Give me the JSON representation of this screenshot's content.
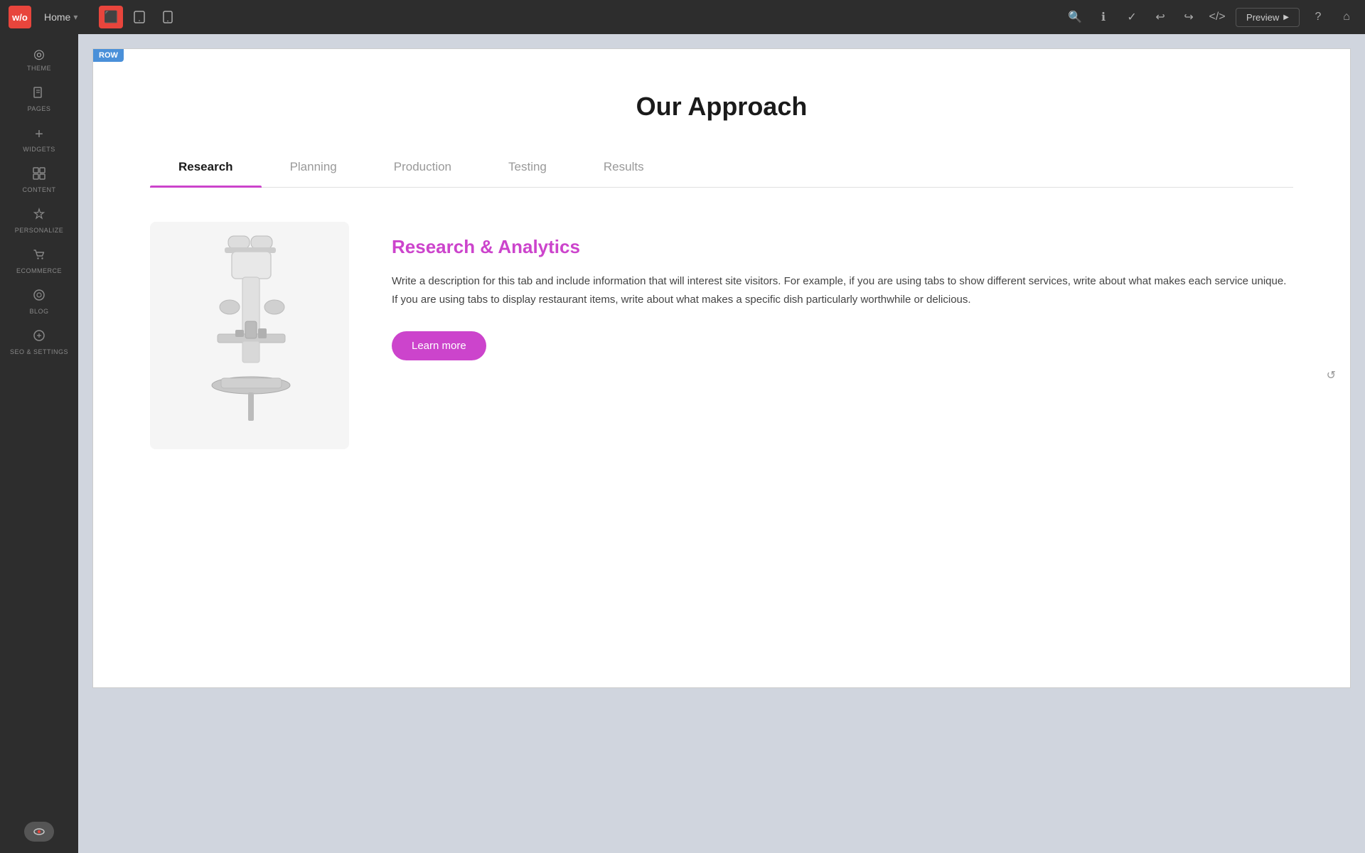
{
  "toolbar": {
    "logo_text": "w/o",
    "home_label": "Home",
    "preview_label": "Preview",
    "devices": [
      {
        "id": "desktop",
        "icon": "🖥",
        "active": true
      },
      {
        "id": "tablet",
        "icon": "⬜",
        "active": false
      },
      {
        "id": "mobile",
        "icon": "📱",
        "active": false
      }
    ],
    "actions": [
      "search",
      "info",
      "check",
      "undo",
      "redo",
      "code",
      "help",
      "home"
    ]
  },
  "sidebar": {
    "items": [
      {
        "id": "theme",
        "icon": "◎",
        "label": "THEME"
      },
      {
        "id": "pages",
        "icon": "📄",
        "label": "PAGES"
      },
      {
        "id": "widgets",
        "icon": "+",
        "label": "WIDGETS"
      },
      {
        "id": "content",
        "icon": "▦",
        "label": "CONTENT"
      },
      {
        "id": "personalize",
        "icon": "✦",
        "label": "PERSONALIZE"
      },
      {
        "id": "ecommerce",
        "icon": "🛒",
        "label": "ECOMMERCE"
      },
      {
        "id": "blog",
        "icon": "◎",
        "label": "BLOG"
      },
      {
        "id": "seo",
        "icon": "⚙",
        "label": "SEO & SETTINGS"
      }
    ]
  },
  "row_badge": "ROW",
  "page": {
    "section_title": "Our Approach",
    "tabs": [
      {
        "id": "research",
        "label": "Research",
        "active": true
      },
      {
        "id": "planning",
        "label": "Planning",
        "active": false
      },
      {
        "id": "production",
        "label": "Production",
        "active": false
      },
      {
        "id": "testing",
        "label": "Testing",
        "active": false
      },
      {
        "id": "results",
        "label": "Results",
        "active": false
      }
    ],
    "active_tab_content": {
      "title": "Research & Analytics",
      "description": "Write a description for this tab and include information that will interest site visitors. For example, if you are using tabs to show different services, write about what makes each service unique. If you are using tabs to display restaurant items, write about what makes a specific dish particularly worthwhile or delicious.",
      "button_label": "Learn more"
    }
  }
}
